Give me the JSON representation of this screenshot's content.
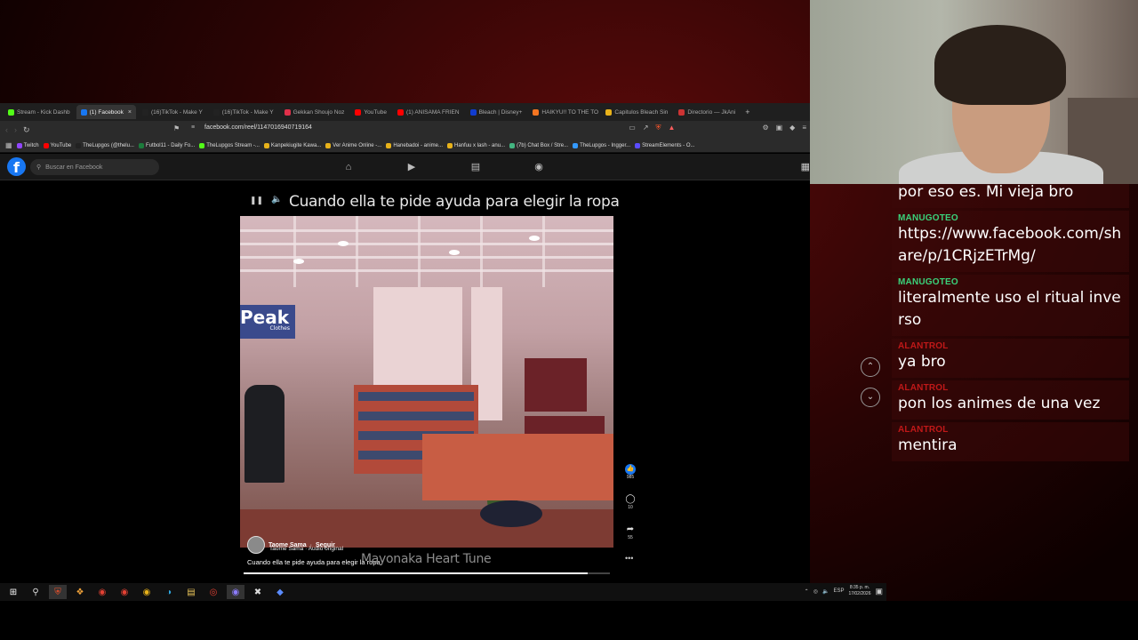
{
  "browser": {
    "tabs": [
      {
        "label": "Stream - Kick Dashb",
        "color": "#53fc18",
        "active": false
      },
      {
        "label": "(1) Facebook",
        "color": "#1877f2",
        "active": true
      },
      {
        "label": "(16)TikTok - Make Y",
        "color": "#222222",
        "active": false
      },
      {
        "label": "(16)TikTok - Make Y",
        "color": "#222222",
        "active": false
      },
      {
        "label": "Gekkan Shoujo Noz",
        "color": "#e0304a",
        "active": false
      },
      {
        "label": "YouTube",
        "color": "#ff0000",
        "active": false
      },
      {
        "label": "(1) ANISAMA FRIEN",
        "color": "#ff0000",
        "active": false
      },
      {
        "label": "Bleach | Disney+",
        "color": "#113ccf",
        "active": false
      },
      {
        "label": "HAIKYU!! TO THE TO",
        "color": "#f47521",
        "active": false
      },
      {
        "label": "Capitulos Bleach Sin",
        "color": "#e8b21a",
        "active": false
      },
      {
        "label": "Directorio — JkAni",
        "color": "#cc3333",
        "active": false
      }
    ],
    "url": "facebook.com/reel/1147016940719164",
    "bookmarks": [
      {
        "label": "Twitch",
        "color": "#9146ff"
      },
      {
        "label": "YouTube",
        "color": "#ff0000"
      },
      {
        "label": "TheLupgos (@thelu...",
        "color": "#222222"
      },
      {
        "label": "Futbol11 - Daily Fo...",
        "color": "#1c7c3c"
      },
      {
        "label": "TheLupgos Stream -...",
        "color": "#53fc18"
      },
      {
        "label": "Kanpekiugite Kawa...",
        "color": "#e8b21a"
      },
      {
        "label": "Ver Anime Online -...",
        "color": "#e8b21a"
      },
      {
        "label": "Hanebadoi - anime...",
        "color": "#e8b21a"
      },
      {
        "label": "Hanfuu x lash - anu...",
        "color": "#e8b21a"
      },
      {
        "label": "(7b) Chat Box / Stre...",
        "color": "#43b581"
      },
      {
        "label": "TheLupgos - Ingger...",
        "color": "#3399ff"
      },
      {
        "label": "StreamElements - O...",
        "color": "#5b4cff"
      }
    ]
  },
  "facebook": {
    "logo": "f",
    "search_placeholder": "Buscar en Facebook"
  },
  "reel": {
    "title": "Cuando ella te pide ayuda para elegir la ropa",
    "sign_text": "Peak",
    "sign_sub": "Clothes",
    "author": "Taome Sama",
    "follow": "Seguir",
    "audio": "Taome Sama · Audio original",
    "caption": "Cuando ella te pide ayuda para elegir la ropa",
    "subtitle": "Mayonaka Heart Tune",
    "progress": 0.94,
    "likes": "985",
    "comments": "10",
    "shares": "55"
  },
  "taskbar": {
    "lang": "ESP",
    "time": "8:35 p. m.",
    "date": "17/02/2026"
  },
  "chat": {
    "messages": [
      {
        "user": "",
        "user_color": "#3ad17a",
        "text": "por eso es. Mi vieja bro"
      },
      {
        "user": "MANUGOTEO",
        "user_color": "#3ad17a",
        "text": "https://www.facebook.com/share/p/1CRjzETrMg/"
      },
      {
        "user": "MANUGOTEO",
        "user_color": "#3ad17a",
        "text": "literalmente uso el ritual inverso"
      },
      {
        "user": "ALANTROL",
        "user_color": "#c01818",
        "text": "ya bro"
      },
      {
        "user": "ALANTROL",
        "user_color": "#c01818",
        "text": "pon los animes de una vez"
      },
      {
        "user": "ALANTROL",
        "user_color": "#c01818",
        "text": "mentira"
      }
    ]
  }
}
